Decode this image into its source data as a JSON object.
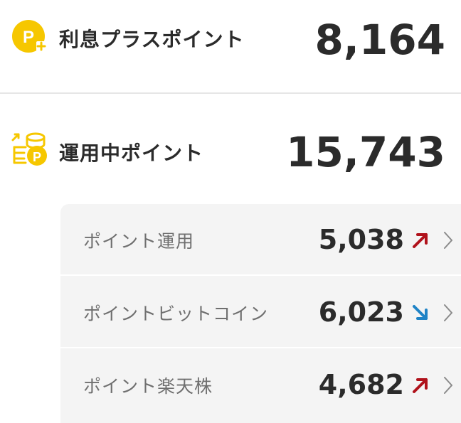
{
  "interest_plus": {
    "label": "利息プラスポイント",
    "value": "8,164",
    "icon": "p-plus-icon"
  },
  "invested": {
    "label": "運用中ポイント",
    "value": "15,743",
    "icon": "coins-p-icon"
  },
  "breakdown": [
    {
      "label": "ポイント運用",
      "value": "5,038",
      "trend": "up",
      "trend_color": "#b0121b"
    },
    {
      "label": "ポイントビットコイン",
      "value": "6,023",
      "trend": "down",
      "trend_color": "#1f83c6"
    },
    {
      "label": "ポイント楽天株",
      "value": "4,682",
      "trend": "up",
      "trend_color": "#b0121b"
    }
  ],
  "colors": {
    "accent_yellow": "#f6c700",
    "trend_up": "#b0121b",
    "trend_down": "#1f83c6",
    "text": "#2b2b2b",
    "muted": "#6f6f6f"
  }
}
